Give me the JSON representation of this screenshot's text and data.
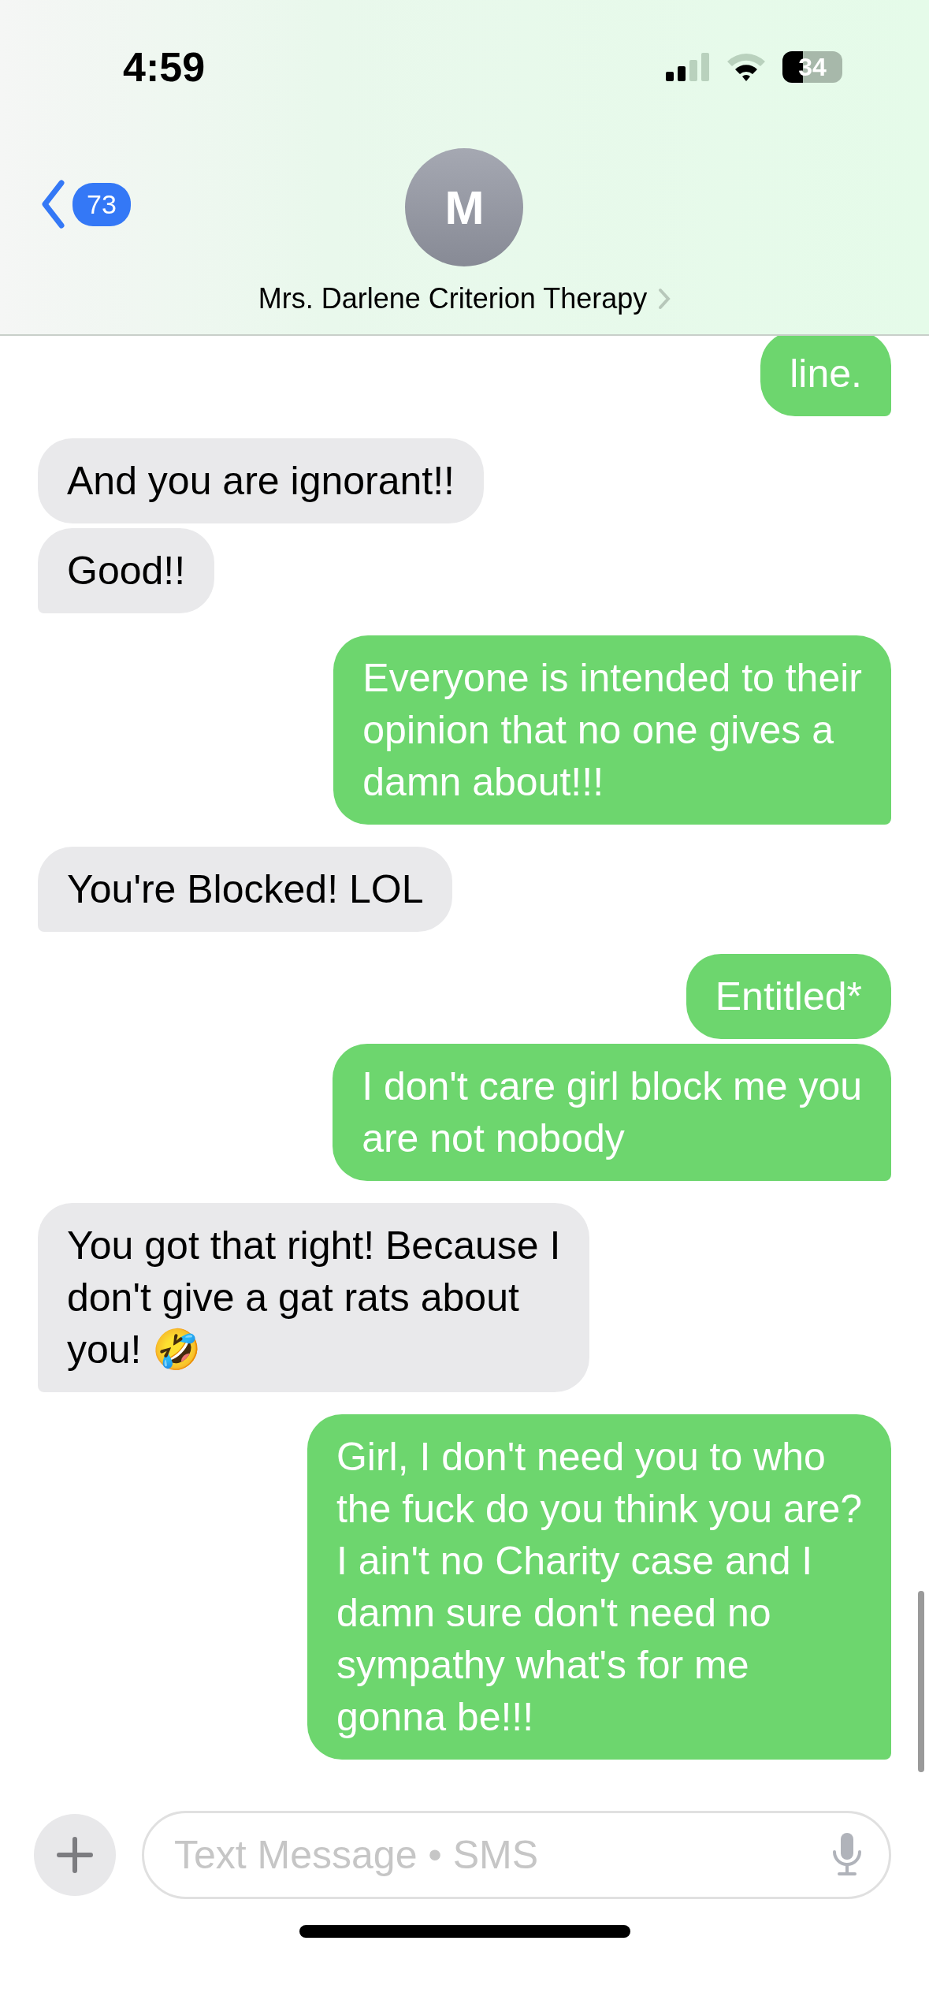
{
  "status_bar": {
    "time": "4:59",
    "battery": "34"
  },
  "header": {
    "back_count": "73",
    "avatar_initial": "M",
    "contact_name": "Mrs. Darlene Criterion Therapy"
  },
  "messages": [
    {
      "kind": "sent",
      "text": "line."
    },
    {
      "kind": "received",
      "text": "And you are ignorant!!"
    },
    {
      "kind": "received",
      "text": "Good!!"
    },
    {
      "kind": "sent",
      "text": "Everyone is intended to their\nopinion that no one gives a\ndamn about!!!"
    },
    {
      "kind": "received",
      "text": "You're Blocked! LOL"
    },
    {
      "kind": "sent",
      "text": "Entitled*"
    },
    {
      "kind": "sent",
      "text": "I don't care girl block me you\nare not nobody"
    },
    {
      "kind": "received",
      "text": "You got that right! Because I\ndon't give a gat rats about\nyou! 🤣"
    },
    {
      "kind": "sent",
      "text": "Girl, I don't need you to who\nthe fuck do you think you are?\nI ain't no Charity case and I\ndamn sure don't need no\nsympathy what's for me\ngonna be!!!"
    }
  ],
  "composer": {
    "placeholder": "Text Message • SMS"
  }
}
